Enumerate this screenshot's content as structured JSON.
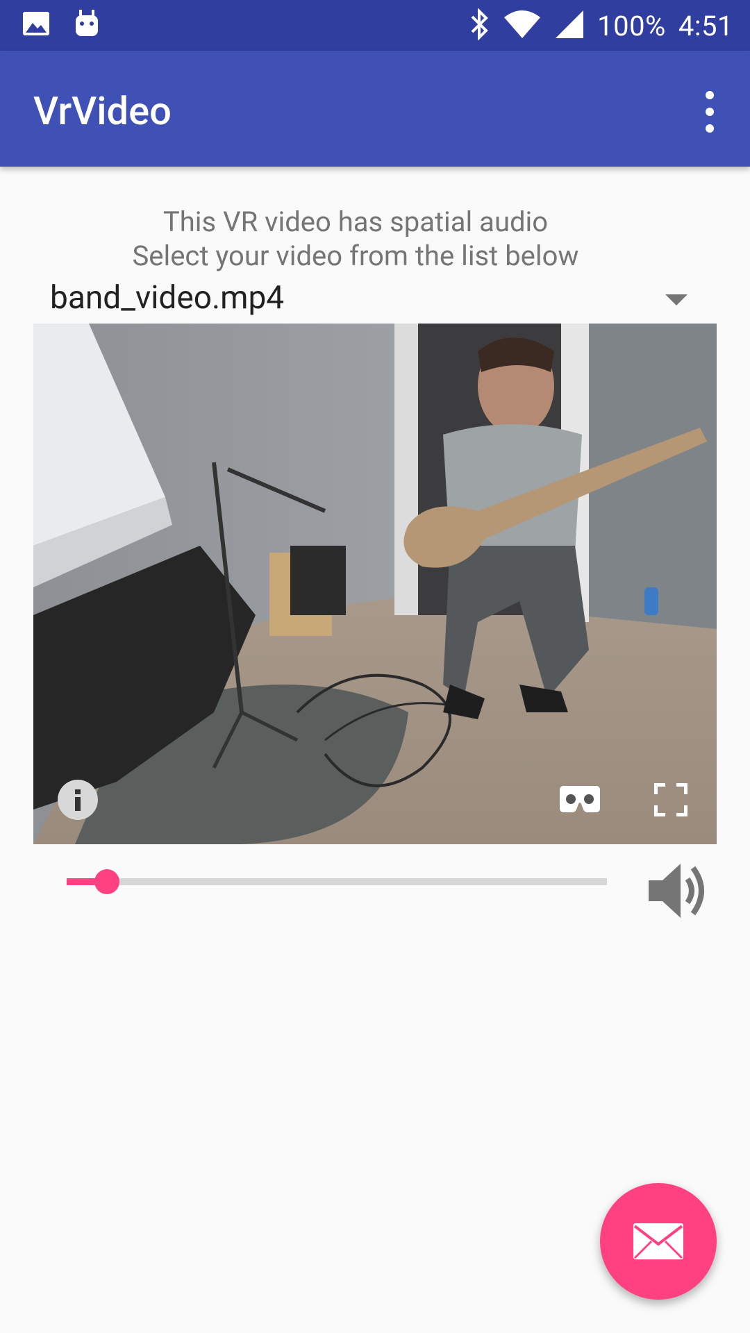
{
  "status_bar": {
    "battery_text": "100%",
    "time": "4:51",
    "icons": [
      "gallery-icon",
      "android-icon",
      "bluetooth-icon",
      "wifi-icon",
      "cellular-signal-icon"
    ]
  },
  "app_bar": {
    "title": "VrVideo",
    "menu_icon": "more-vert-icon"
  },
  "info": {
    "line1": "This VR video has spatial audio",
    "line2": "Select your video from the list below"
  },
  "video_selector": {
    "selected": "band_video.mp4"
  },
  "video": {
    "controls": [
      "info-icon",
      "cardboard-icon",
      "fullscreen-icon"
    ]
  },
  "seek": {
    "progress_fraction": 0.075
  },
  "colors": {
    "primary": "#3f51b5",
    "primary_dark": "#303f9f",
    "accent": "#ff4081",
    "background": "#fafafa"
  },
  "fab": {
    "icon": "email-icon"
  }
}
